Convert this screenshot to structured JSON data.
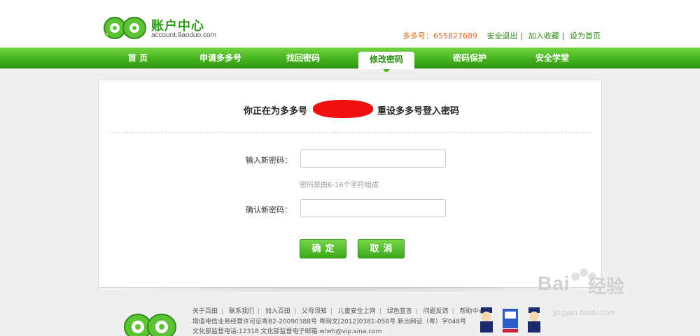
{
  "header": {
    "logo_title": "账户中心",
    "logo_url": "account.9aoduo.com",
    "account_label": "多多号：",
    "account_number": "655827689",
    "links": [
      "安全退出",
      "加入收藏",
      "设为首页"
    ]
  },
  "nav": {
    "items": [
      "首 页",
      "申请多多号",
      "找回密码",
      "修改密码",
      "密码保护",
      "安全学堂"
    ],
    "active": "修改密码"
  },
  "form": {
    "headline_pre": "你正在为多多号",
    "headline_post": "重设多多号登入密码",
    "new_password_label": "输入新密码：",
    "new_password_value": "",
    "hint": "密码是由6-16个字符组成",
    "confirm_password_label": "确认新密码：",
    "confirm_password_value": "",
    "confirm_button": "确定",
    "cancel_button": "取消"
  },
  "footer": {
    "links": [
      "关于百田",
      "联系我们",
      "加入百田",
      "父母须知",
      "儿童安全上网",
      "绿色宣言",
      "问题反馈",
      "帮助中心"
    ],
    "license_line": "增值电信业务经营许可证粤B2-20090388号  粤网文[2012]0381-058号  新出网证（粤）字048号",
    "supervision_line": "文化部监督电话:12318  文化部监督电子邮箱:wlwh@vip.sina.com"
  },
  "watermark": {
    "brand": "Bai",
    "brand_suffix": "经验",
    "url": "jingyan.baidu.com"
  },
  "colors": {
    "brand_green": "#43b01d",
    "account_orange": "#e8681a",
    "redaction": "#f01010"
  }
}
